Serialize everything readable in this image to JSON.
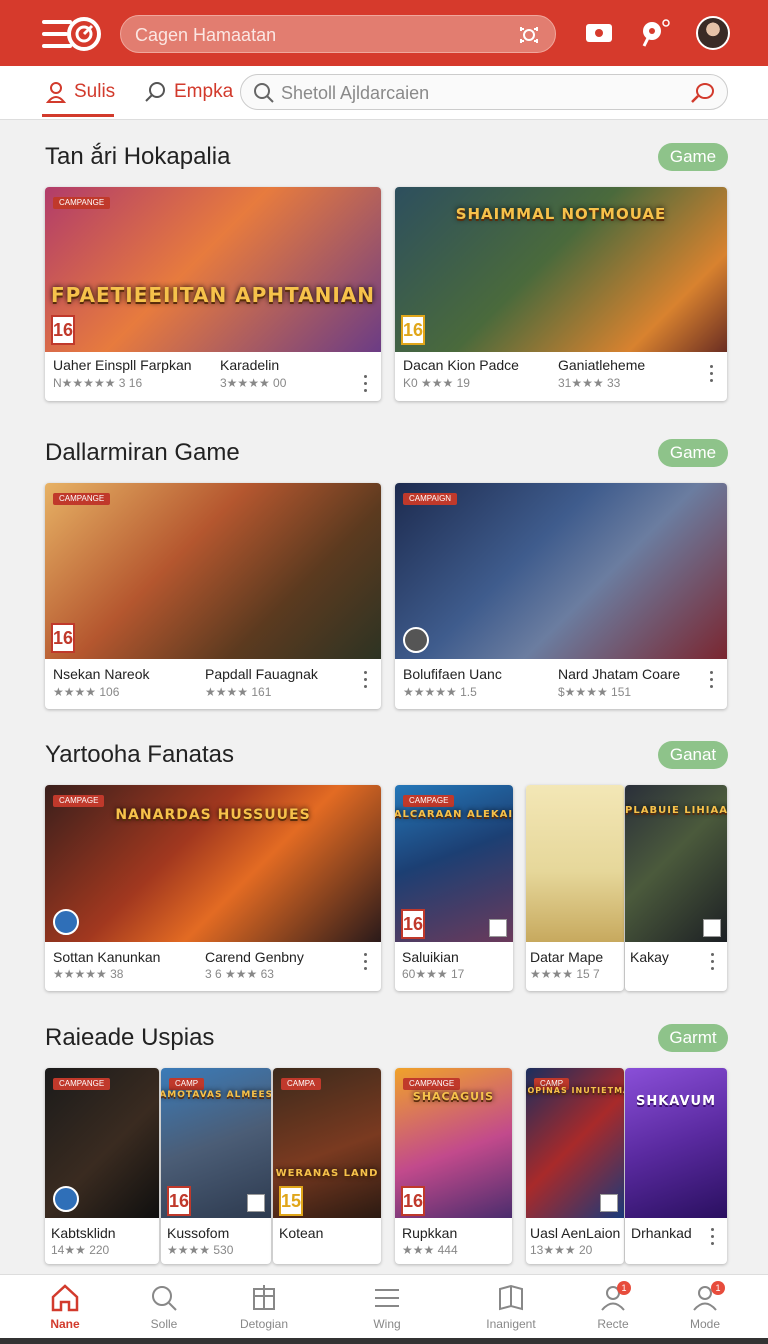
{
  "app": {
    "accent": "#d63a2c",
    "search_placeholder": "Cagen Hamaatan",
    "icons": [
      "menu-logo-icon",
      "camera-icon",
      "video-icon",
      "location-icon",
      "avatar"
    ]
  },
  "tabs": {
    "items": [
      {
        "label": "Sulis",
        "icon": "person-icon",
        "active": true
      },
      {
        "label": "Empka",
        "icon": "search-icon",
        "active": false
      }
    ],
    "search_placeholder": "Shetoll Ajldarcaien"
  },
  "sections": [
    {
      "title": "Tan ắri Hokapalia",
      "chip": "Game",
      "cards": [
        {
          "tag": "CAMPANGE",
          "logo": "FPAETIEEIITAN APHTANIAN",
          "age": "16",
          "name1": "Uaher Einspll Farpkan",
          "sub1": "N★★★★★ 3 16",
          "name2": "Karadelin",
          "sub2": "3★★★★ 00"
        },
        {
          "tag": "",
          "logo": "SHAIMMAL NOTMOUAE",
          "age": "16",
          "name1": "Dacan Kion Padce",
          "sub1": "K0 ★★★ 19",
          "name2": "Ganiatleheme",
          "sub2": "31★★★ 33"
        }
      ]
    },
    {
      "title": "Dallarmiran Game",
      "chip": "Game",
      "cards": [
        {
          "tag": "CAMPANGE",
          "logo": "",
          "age": "16",
          "name1": "Nsekan Nareok",
          "sub1": "★★★★ 106",
          "name2": "Papdall Fauagnak",
          "sub2": "★★★★ 161"
        },
        {
          "tag": "CAMPAIGN",
          "logo": "",
          "age": "",
          "name1": "Bolufifaen Uanc",
          "sub1": "★★★★★ 1.5",
          "name2": "Nard Jhatam Coare",
          "sub2": "$★★★★ 151"
        }
      ]
    },
    {
      "title": "Yartooha Fanatas",
      "chip": "Ganat",
      "cards": [
        {
          "tag": "CAMPAGE",
          "logo": "NANARDAS HUSSUUES",
          "name1": "Sottan Kanunkan",
          "sub1": "★★★★★ 38",
          "name2": "Carend Genbny",
          "sub2": "3 6 ★★★ 63"
        },
        {
          "tag": "CAMPAGE",
          "logo": "SALCARAAN ALEKAIN",
          "age": "16",
          "name1": "Saluikian",
          "sub1": "60★★★ 17"
        },
        {
          "tag": "",
          "logo": "",
          "name1": "Datar Mape",
          "sub1": "★★★★ 15  7"
        },
        {
          "tag": "",
          "logo": "GPLABUIE LIHIAAS",
          "name1": "Kakay",
          "sub1": ""
        }
      ]
    },
    {
      "title": "Raieade Uspias",
      "chip": "Garmt",
      "cards": [
        {
          "tag": "CAMPANGE",
          "logo": "",
          "name1": "Kabtsklidn",
          "sub1": "14★★ 220"
        },
        {
          "tag": "CAMP",
          "logo": "SAMOTAVAS ALMEESS",
          "age": "16",
          "name1": "Kussofom",
          "sub1": "★★★★ 530"
        },
        {
          "tag": "CAMPA",
          "logo": "WERANAS LAND",
          "age": "15",
          "name1": "Kotean",
          "sub1": ""
        },
        {
          "tag": "CAMPANGE",
          "logo": "SHACAGUIS",
          "age": "16",
          "name1": "Rupkkan",
          "sub1": "★★★ 444"
        },
        {
          "tag": "CAMP",
          "logo": "SHOPINAS INUTIETMAS",
          "name1": "Uasl AenLaion",
          "sub1": "13★★★ 20"
        },
        {
          "tag": "",
          "logo": "SHKAVUM",
          "name1": "Drhankad",
          "sub1": ""
        }
      ]
    }
  ],
  "bottom_nav": [
    {
      "label": "Nane",
      "icon": "home-icon",
      "active": true
    },
    {
      "label": "Solle",
      "icon": "search-icon"
    },
    {
      "label": "Detogian",
      "icon": "gift-icon"
    },
    {
      "label": "Wing",
      "icon": "list-icon"
    },
    {
      "label": "Inanigent",
      "icon": "book-icon"
    },
    {
      "label": "Recte",
      "icon": "profile-icon",
      "badge": "1"
    },
    {
      "label": "Mode",
      "icon": "user-icon",
      "badge": "1"
    }
  ]
}
